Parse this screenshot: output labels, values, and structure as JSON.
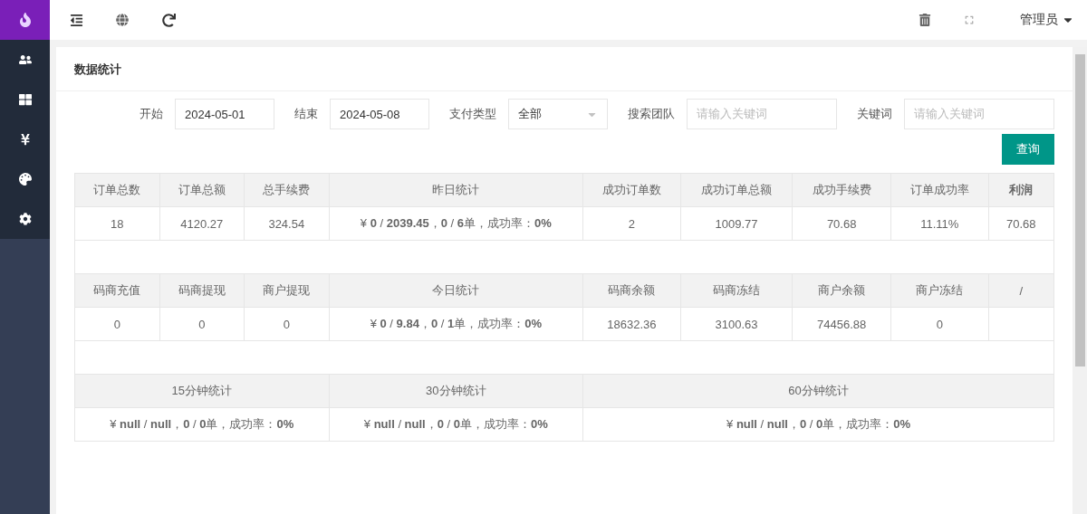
{
  "topbar": {
    "user": "管理员"
  },
  "card": {
    "title": "数据统计"
  },
  "filters": [
    {
      "kind": "date",
      "label": "开始",
      "value": "2024-05-01"
    },
    {
      "kind": "date",
      "label": "结束",
      "value": "2024-05-08"
    },
    {
      "kind": "select",
      "label": "支付类型",
      "value": "全部"
    },
    {
      "kind": "text",
      "label": "搜索团队",
      "placeholder": "请输入关键词"
    },
    {
      "kind": "text",
      "label": "关键词",
      "placeholder": "请输入关键词"
    }
  ],
  "query_button": "查询",
  "sections": [
    {
      "kind": "columns",
      "headers": [
        {
          "text": "订单总数",
          "bold": false
        },
        {
          "text": "订单总额",
          "bold": false
        },
        {
          "text": "总手续费",
          "bold": false
        },
        {
          "text": "昨日统计",
          "bold": false
        },
        {
          "text": "成功订单数",
          "bold": false
        },
        {
          "text": "成功订单总额",
          "bold": false
        },
        {
          "text": "成功手续费",
          "bold": false
        },
        {
          "text": "订单成功率",
          "bold": false
        },
        {
          "text": "利润",
          "bold": true
        }
      ],
      "values": [
        "18",
        "4120.27",
        "324.54",
        "¥ **0** / **2039.45**，**0** / **6**单，成功率：**0%**",
        "2",
        "1009.77",
        "70.68",
        "11.11%",
        "70.68"
      ]
    },
    {
      "kind": "columns",
      "headers": [
        {
          "text": "码商充值",
          "bold": false
        },
        {
          "text": "码商提现",
          "bold": false
        },
        {
          "text": "商户提现",
          "bold": false
        },
        {
          "text": "今日统计",
          "bold": false
        },
        {
          "text": "码商余额",
          "bold": false
        },
        {
          "text": "码商冻结",
          "bold": false
        },
        {
          "text": "商户余额",
          "bold": false
        },
        {
          "text": "商户冻结",
          "bold": false
        },
        {
          "text": "/",
          "bold": false
        }
      ],
      "values": [
        "0",
        "0",
        "0",
        "¥ **0** / **9.84**，**0** / **1**单，成功率：**0%**",
        "18632.36",
        "3100.63",
        "74456.88",
        "0"
      ]
    },
    {
      "kind": "periods",
      "headers": [
        {
          "text": "15分钟统计",
          "bold": false
        },
        {
          "text": "30分钟统计",
          "bold": false
        },
        {
          "text": "60分钟统计",
          "bold": false
        }
      ],
      "values": [
        "¥ **null** / **null**，**0** / **0**单，成功率：**0%**",
        "¥ **null** / **null**，**0** / **0**单，成功率：**0%**",
        "¥ **null** / **null**，**0** / **0**单，成功率：**0%**"
      ]
    }
  ]
}
